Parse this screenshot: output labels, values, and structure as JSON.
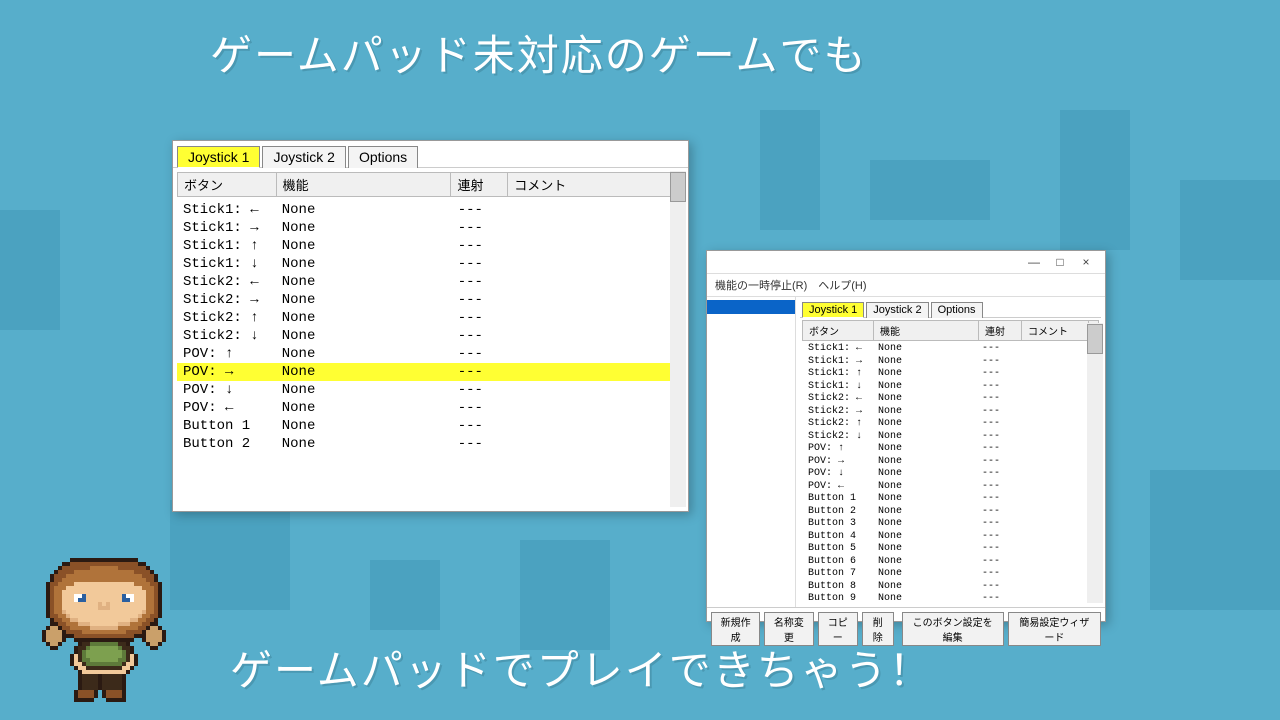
{
  "headline_top": "ゲームパッド未対応のゲームでも",
  "headline_bottom": "ゲームパッドでプレイできちゃう！",
  "window_large": {
    "tabs": [
      "Joystick 1",
      "Joystick 2",
      "Options"
    ],
    "selected_tab": 0,
    "columns": {
      "button": "ボタン",
      "func": "機能",
      "rapid": "連射",
      "comment": "コメント"
    },
    "col_widths": {
      "button": 90,
      "func": 170,
      "rapid": 46,
      "comment": 170
    },
    "selected_row": 9,
    "rows": [
      {
        "b": "Stick1: ←",
        "f": "None",
        "r": "---",
        "c": ""
      },
      {
        "b": "Stick1: →",
        "f": "None",
        "r": "---",
        "c": ""
      },
      {
        "b": "Stick1: ↑",
        "f": "None",
        "r": "---",
        "c": ""
      },
      {
        "b": "Stick1: ↓",
        "f": "None",
        "r": "---",
        "c": ""
      },
      {
        "b": "Stick2: ←",
        "f": "None",
        "r": "---",
        "c": ""
      },
      {
        "b": "Stick2: →",
        "f": "None",
        "r": "---",
        "c": ""
      },
      {
        "b": "Stick2: ↑",
        "f": "None",
        "r": "---",
        "c": ""
      },
      {
        "b": "Stick2: ↓",
        "f": "None",
        "r": "---",
        "c": ""
      },
      {
        "b": "POV: ↑",
        "f": "None",
        "r": "---",
        "c": ""
      },
      {
        "b": "POV: →",
        "f": "None",
        "r": "---",
        "c": ""
      },
      {
        "b": "POV: ↓",
        "f": "None",
        "r": "---",
        "c": ""
      },
      {
        "b": "POV: ←",
        "f": "None",
        "r": "---",
        "c": ""
      },
      {
        "b": "Button 1",
        "f": "None",
        "r": "---",
        "c": ""
      },
      {
        "b": "Button 2",
        "f": "None",
        "r": "---",
        "c": ""
      }
    ]
  },
  "window_small": {
    "titlebar": {
      "min": "—",
      "max": "□",
      "close": "×"
    },
    "menu": "機能の一時停止(R)　ヘルプ(H)",
    "tabs": [
      "Joystick 1",
      "Joystick 2",
      "Options"
    ],
    "selected_tab": 0,
    "columns": {
      "button": "ボタン",
      "func": "機能",
      "rapid": "連射",
      "comment": "コメント"
    },
    "col_widths": {
      "button": 58,
      "func": 92,
      "rapid": 30,
      "comment": 54
    },
    "rows": [
      {
        "b": "Stick1: ←",
        "f": "None",
        "r": "---"
      },
      {
        "b": "Stick1: →",
        "f": "None",
        "r": "---"
      },
      {
        "b": "Stick1: ↑",
        "f": "None",
        "r": "---"
      },
      {
        "b": "Stick1: ↓",
        "f": "None",
        "r": "---"
      },
      {
        "b": "Stick2: ←",
        "f": "None",
        "r": "---"
      },
      {
        "b": "Stick2: →",
        "f": "None",
        "r": "---"
      },
      {
        "b": "Stick2: ↑",
        "f": "None",
        "r": "---"
      },
      {
        "b": "Stick2: ↓",
        "f": "None",
        "r": "---"
      },
      {
        "b": "POV: ↑",
        "f": "None",
        "r": "---"
      },
      {
        "b": "POV: →",
        "f": "None",
        "r": "---"
      },
      {
        "b": "POV: ↓",
        "f": "None",
        "r": "---"
      },
      {
        "b": "POV: ←",
        "f": "None",
        "r": "---"
      },
      {
        "b": "Button 1",
        "f": "None",
        "r": "---"
      },
      {
        "b": "Button 2",
        "f": "None",
        "r": "---"
      },
      {
        "b": "Button 3",
        "f": "None",
        "r": "---"
      },
      {
        "b": "Button 4",
        "f": "None",
        "r": "---"
      },
      {
        "b": "Button 5",
        "f": "None",
        "r": "---"
      },
      {
        "b": "Button 6",
        "f": "None",
        "r": "---"
      },
      {
        "b": "Button 7",
        "f": "None",
        "r": "---"
      },
      {
        "b": "Button 8",
        "f": "None",
        "r": "---"
      },
      {
        "b": "Button 9",
        "f": "None",
        "r": "---"
      }
    ],
    "buttons_left": [
      "新規作成",
      "名称変更",
      "コピー",
      "削除"
    ],
    "buttons_right": [
      "このボタン設定を編集",
      "簡易設定ウィザード"
    ]
  }
}
